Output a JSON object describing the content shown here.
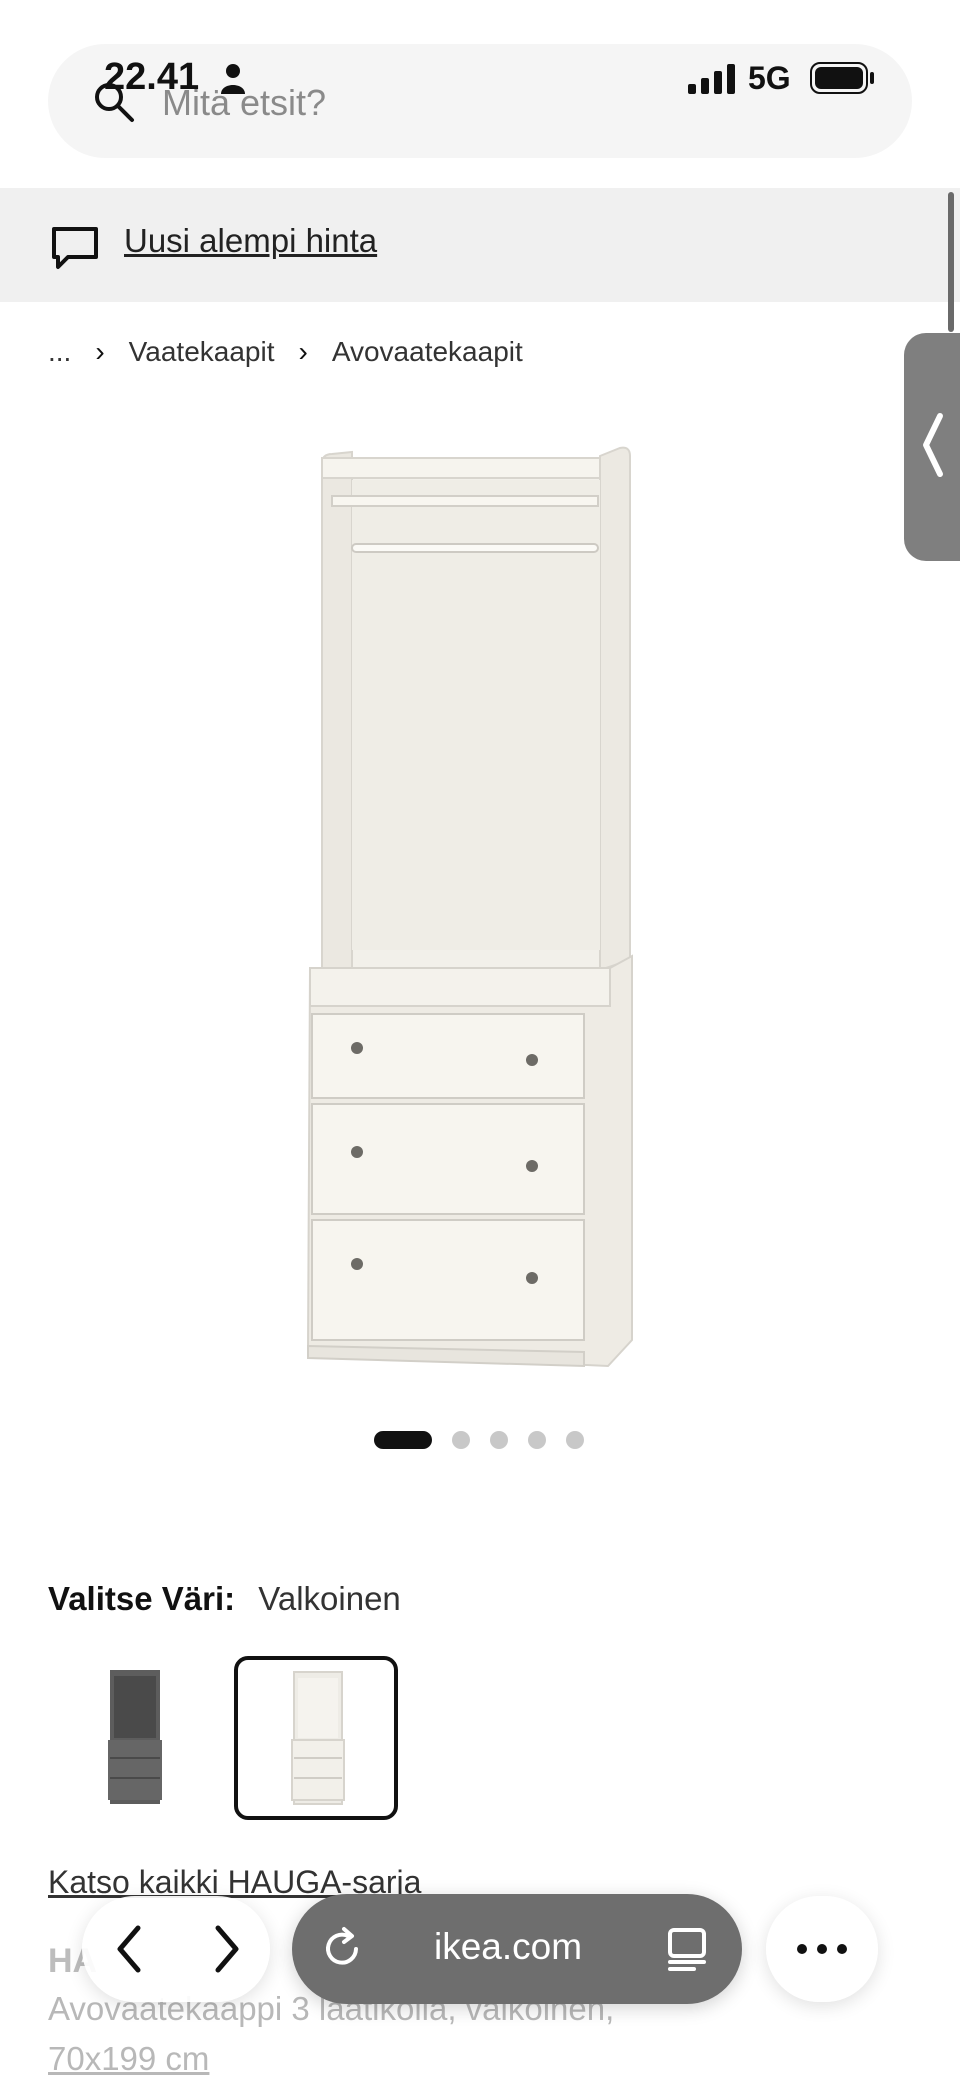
{
  "status_bar": {
    "time": "22.41",
    "network": "5G"
  },
  "search": {
    "placeholder": "Mitä etsit?"
  },
  "promo": {
    "link_text": "Uusi alempi hinta"
  },
  "breadcrumb": {
    "items": [
      "...",
      "Vaatekaapit",
      "Avovaatekaapit"
    ]
  },
  "gallery": {
    "image_count": 5,
    "active_index": 0
  },
  "color_picker": {
    "label": "Valitse Väri:",
    "selected": "Valkoinen",
    "swatches": [
      "grey-variant",
      "white-variant"
    ]
  },
  "series_link": "Katso kaikki HAUGA-sarja",
  "product": {
    "name": "HA",
    "description": "Avovaatekaappi 3 laatikolla, valkoinen,",
    "size": "70x199 cm"
  },
  "browser": {
    "url": "ikea.com"
  }
}
